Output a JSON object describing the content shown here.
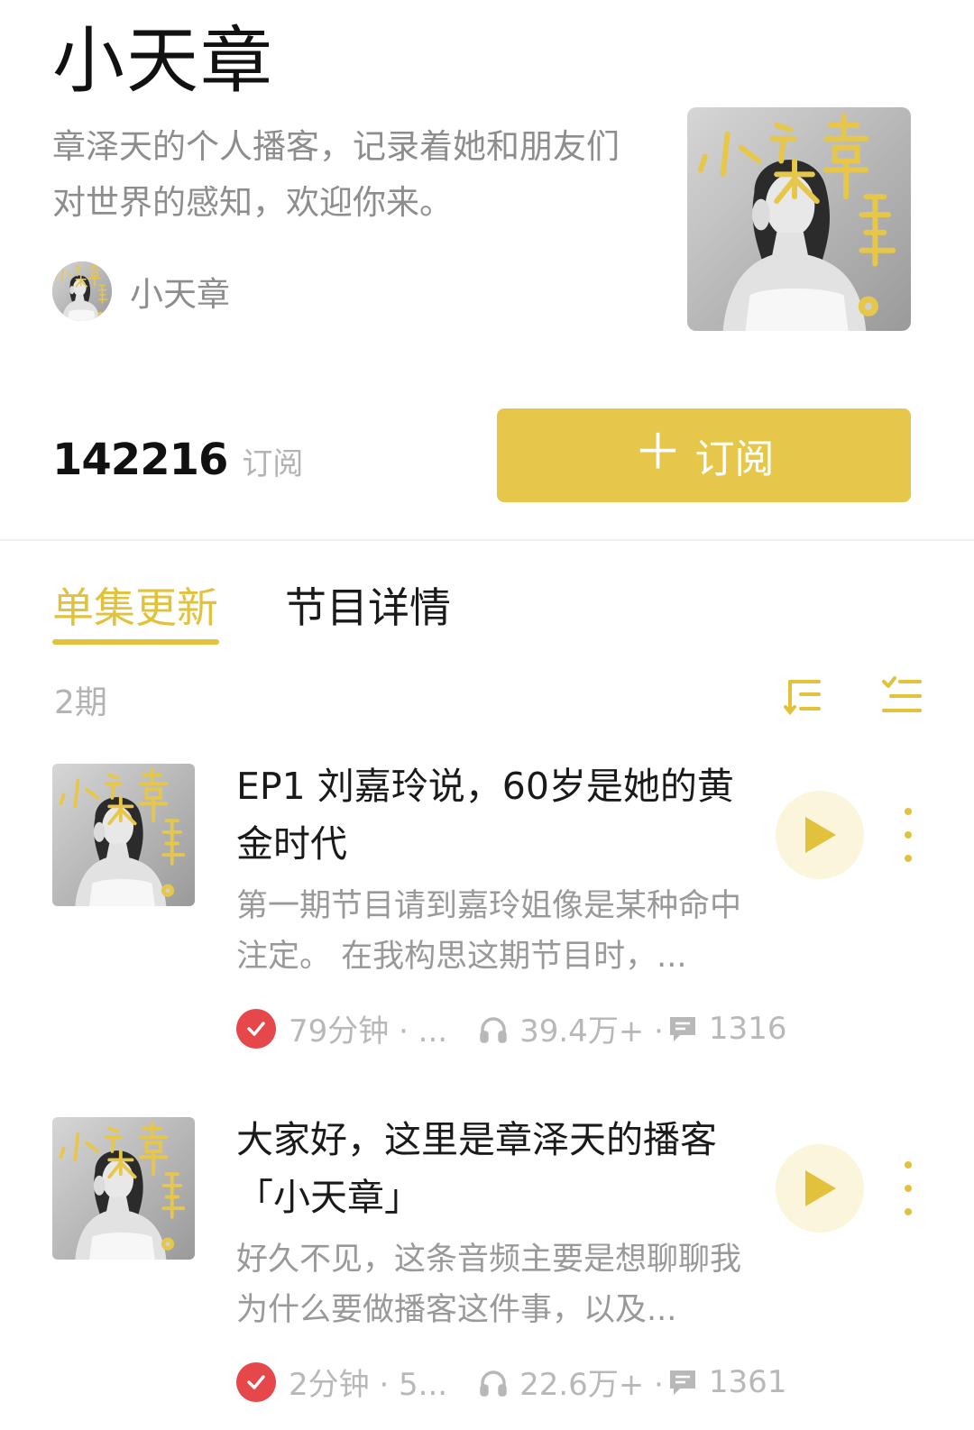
{
  "header": {
    "title": "小天章",
    "description": "章泽天的个人播客，记录着她和朋友们对世界的感知，欢迎你来。",
    "author_name": "小天章"
  },
  "stats": {
    "subscribers": "142216",
    "subscribers_label": "订阅",
    "subscribe_button": "订阅"
  },
  "tabs": [
    {
      "label": "单集更新",
      "active": true
    },
    {
      "label": "节目详情",
      "active": false
    }
  ],
  "list": {
    "episode_count": "2期"
  },
  "episodes": [
    {
      "title": "EP1 刘嘉玲说，60岁是她的黄金时代",
      "description": "第一期节目请到嘉玲姐像是某种命中注定。 在我构思这期节目时，...",
      "duration": "79分钟 · ...",
      "plays": "39.4万+ ·",
      "comments": "1316"
    },
    {
      "title": "大家好，这里是章泽天的播客「小天章」",
      "description": "好久不见，这条音频主要是想聊聊我为什么要做播客这件事，以及...",
      "duration": "2分钟 · 5...",
      "plays": "22.6万+ ·",
      "comments": "1361"
    }
  ],
  "icons": {
    "sort": "sort-icon",
    "filter": "list-filter-icon",
    "play": "play-icon",
    "more": "more-vertical-icon",
    "check": "check-icon",
    "headphone": "headphone-icon",
    "comment": "comment-icon"
  },
  "colors": {
    "accent": "#e2c23c",
    "button": "#e6c74a",
    "play_bg": "#fbf5dc",
    "check": "#e5474b"
  }
}
